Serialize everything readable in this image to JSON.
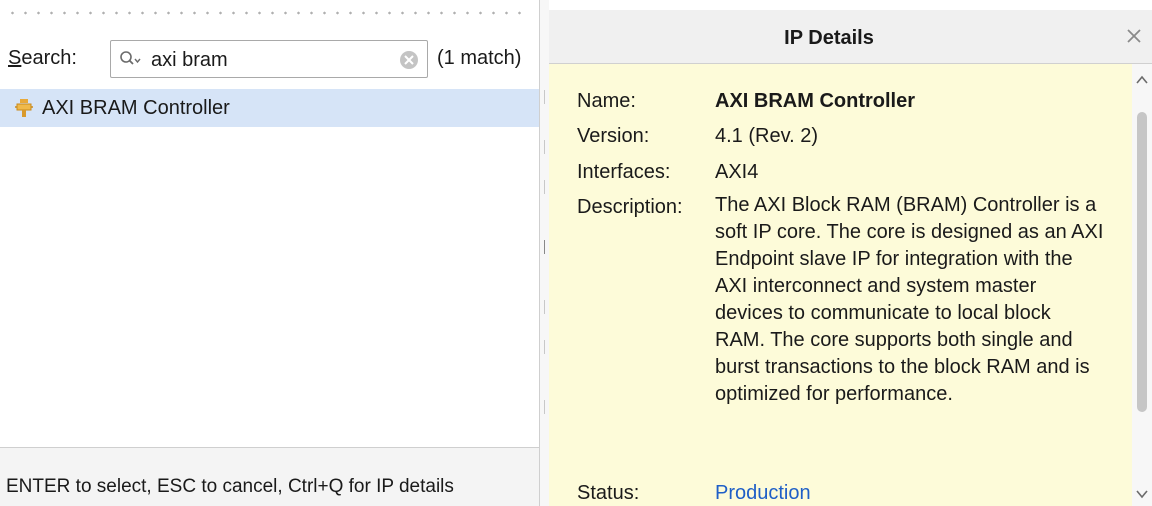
{
  "search": {
    "label": "earch:",
    "label_mnemonic": "S",
    "query": "axi bram",
    "match_count": "(1 match)"
  },
  "results": [
    {
      "label": "AXI BRAM Controller"
    }
  ],
  "footer": {
    "hint": "ENTER to select, ESC to cancel, Ctrl+Q for IP details"
  },
  "details": {
    "title": "IP Details",
    "rows": {
      "name": {
        "label": "Name:",
        "value": "AXI BRAM Controller"
      },
      "version": {
        "label": "Version:",
        "value": "4.1 (Rev. 2)"
      },
      "interfaces": {
        "label": "Interfaces:",
        "value": "AXI4"
      },
      "description": {
        "label": "Description:",
        "value": "The AXI Block RAM (BRAM) Controller is a soft IP core. The core is designed as an AXI Endpoint slave IP for integration with the AXI interconnect and system master devices to communicate to local block RAM. The core supports both single and burst transactions to the block RAM and is optimized for performance."
      },
      "status": {
        "label": "Status:",
        "value": "Production"
      }
    }
  },
  "colors": {
    "selection": "#d6e4f7",
    "details_background": "#fdfbd9",
    "link": "#1f5fc7"
  },
  "icons": {
    "search": "search-icon",
    "clear": "clear-search-icon",
    "ip": "ip-core-icon",
    "close": "close-icon"
  }
}
